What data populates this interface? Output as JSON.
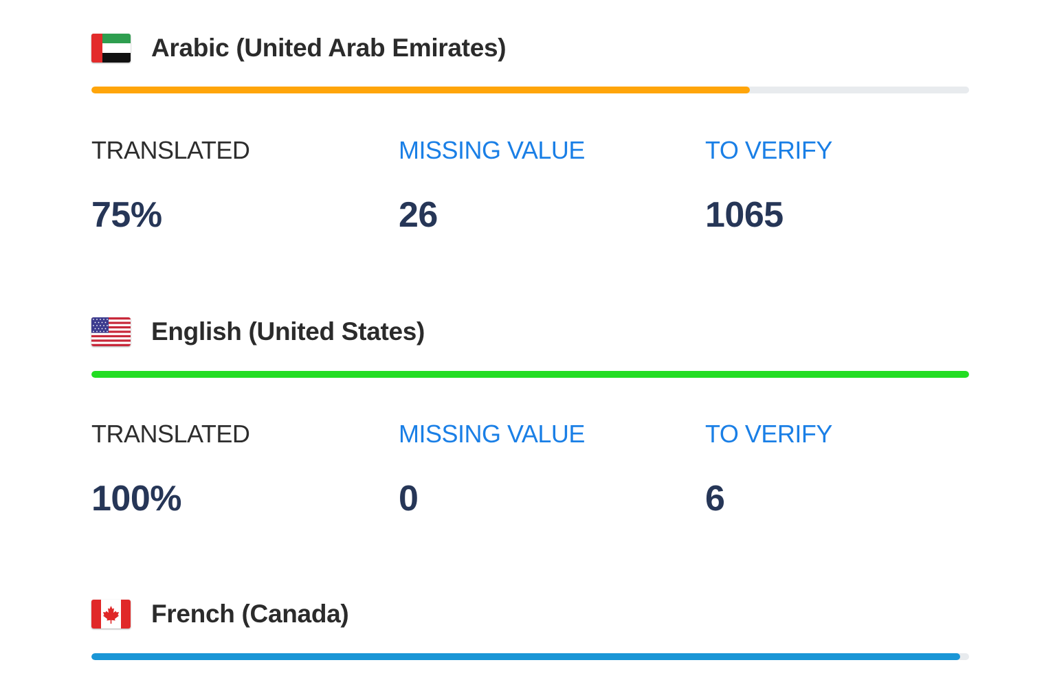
{
  "languages": [
    {
      "name": "Arabic (United Arab Emirates)",
      "flag_icon": "uae-flag-icon",
      "progress_color": "#ffa50a",
      "progress_fraction": 0.75,
      "translated_label": "TRANSLATED",
      "translated_value": "75%",
      "missing_label": "MISSING VALUE",
      "missing_value": "26",
      "verify_label": "TO VERIFY",
      "verify_value": "1065"
    },
    {
      "name": "English (United States)",
      "flag_icon": "us-flag-icon",
      "progress_color": "#22dd22",
      "progress_fraction": 1.0,
      "translated_label": "TRANSLATED",
      "translated_value": "100%",
      "missing_label": "MISSING VALUE",
      "missing_value": "0",
      "verify_label": "TO VERIFY",
      "verify_value": "6"
    },
    {
      "name": "French (Canada)",
      "flag_icon": "canada-flag-icon",
      "progress_color": "#1a96d6",
      "progress_fraction": 0.99
    }
  ],
  "colors": {
    "track": "#e8ebee",
    "link": "#1a7fe6",
    "value": "#263657"
  }
}
